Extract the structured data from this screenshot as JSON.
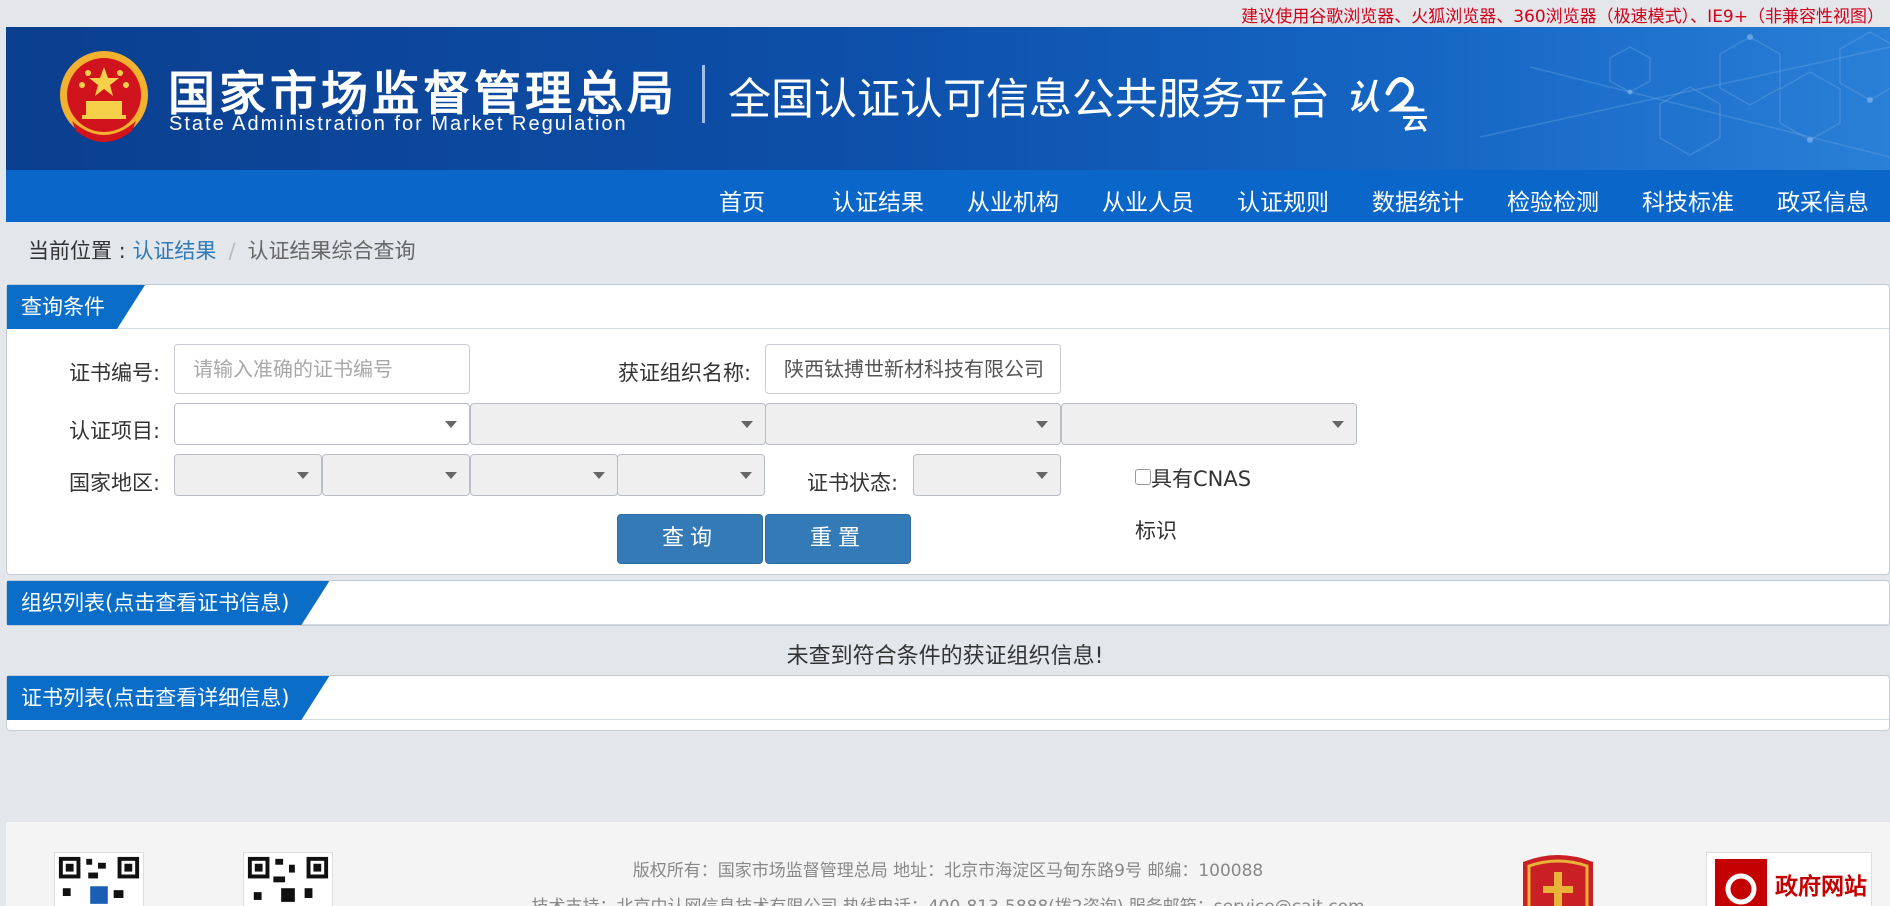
{
  "top_tip": "建议使用谷歌浏览器、火狐浏览器、360浏览器（极速模式）、IE9+（非兼容性视图）",
  "header": {
    "org_cn": "国家市场监督管理总局",
    "org_en": "State Administration  for  Market Regulation",
    "platform": "全国认证认可信息公共服务平台",
    "logo_text": "认云"
  },
  "nav": [
    "首页",
    "认证结果",
    "从业机构",
    "从业人员",
    "认证规则",
    "数据统计",
    "检验检测",
    "科技标准",
    "政采信息"
  ],
  "breadcrumb": {
    "prefix": "当前位置 : ",
    "link": "认证结果",
    "sep": "/",
    "current": "认证结果综合查询"
  },
  "query": {
    "title": "查询条件",
    "cert_no_label": "证书编号:",
    "cert_no_placeholder": "请输入准确的证书编号",
    "org_name_label": "获证组织名称:",
    "org_name_value": "陕西钛搏世新材科技有限公司",
    "project_label": "认证项目:",
    "region_label": "国家地区:",
    "status_label": "证书状态:",
    "cnas_label": "具有CNAS标识",
    "query_btn": "查询",
    "reset_btn": "重置"
  },
  "org_list": {
    "title": "组织列表(点击查看证书信息)",
    "empty": "未查到符合条件的获证组织信息!"
  },
  "cert_list": {
    "title": "证书列表(点击查看详细信息)"
  },
  "footer": {
    "line1": "版权所有：国家市场监督管理总局    地址：北京市海淀区马甸东路9号    邮编：100088",
    "line2": "技术支持：北京中认网信息技术有限公司    热线电话：400-813-5888(拨2咨询)    服务邮箱：service@cait.com",
    "gov_badge": "政府网站"
  },
  "colors": {
    "brand_blue": "#0a66c8",
    "tip_red": "#d0021b",
    "button_blue": "#337ab7"
  }
}
